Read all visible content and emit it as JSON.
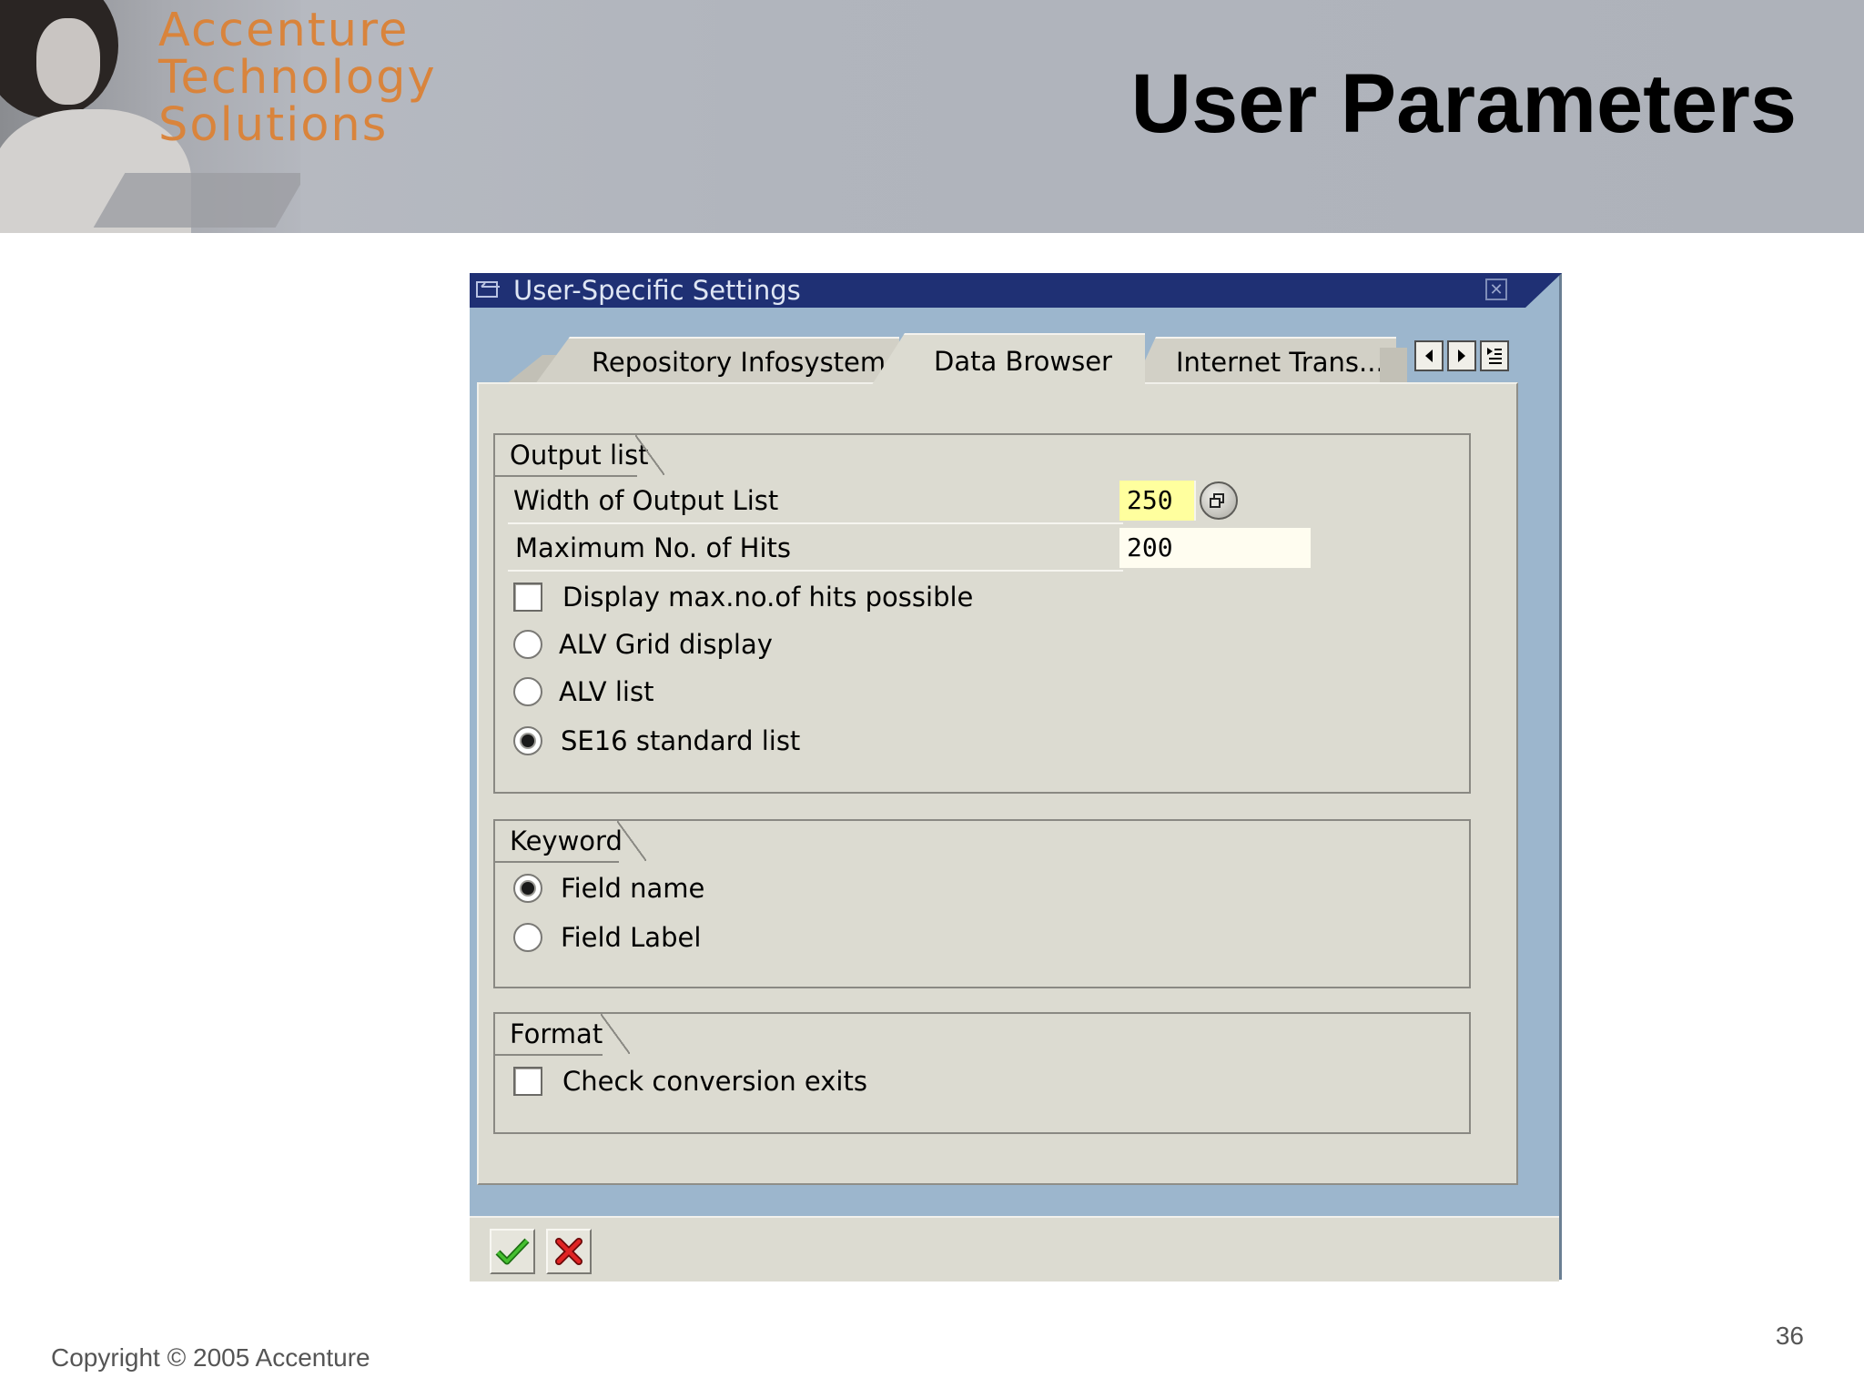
{
  "slide": {
    "title": "User Parameters",
    "logo_lines": [
      "Accenture",
      "Technology",
      "Solutions"
    ],
    "copyright": "Copyright © 2005 Accenture",
    "page_number": "36"
  },
  "dialog": {
    "title": "User-Specific Settings",
    "tabs": [
      {
        "label": "Repository Infosystem",
        "active": false
      },
      {
        "label": "Data Browser",
        "active": true
      },
      {
        "label": "Internet Trans...",
        "active": false
      }
    ],
    "groups": {
      "output_list": {
        "title": "Output list",
        "width_label": "Width of Output List",
        "width_value": "250",
        "max_hits_label": "Maximum No. of Hits",
        "max_hits_value": "200",
        "display_max_label": "Display max.no.of hits possible",
        "display_max_checked": false,
        "radio_options": [
          {
            "label": "ALV Grid display",
            "checked": false
          },
          {
            "label": "ALV list",
            "checked": false
          },
          {
            "label": "SE16 standard list",
            "checked": true
          }
        ]
      },
      "keyword": {
        "title": "Keyword",
        "radio_options": [
          {
            "label": "Field name",
            "checked": true
          },
          {
            "label": "Field Label",
            "checked": false
          }
        ]
      },
      "format": {
        "title": "Format",
        "check_conversion_label": "Check conversion exits",
        "check_conversion_checked": false
      }
    }
  },
  "colors": {
    "logo": "#d9843c",
    "titlebar": "#1f3074",
    "dialog_frame": "#9cb6cd",
    "panel": "#dcdbd1",
    "active_input": "#ffff9e",
    "ok_green": "#2e9c1e",
    "cancel_red": "#d21b1b"
  },
  "icons": {
    "titlebar": "window-icon",
    "close": "close-icon",
    "tab_prev": "arrow-left-icon",
    "tab_next": "arrow-right-icon",
    "tab_list": "tab-list-icon",
    "matchcode": "value-help-icon",
    "ok": "checkmark-icon",
    "cancel": "cancel-x-icon"
  }
}
